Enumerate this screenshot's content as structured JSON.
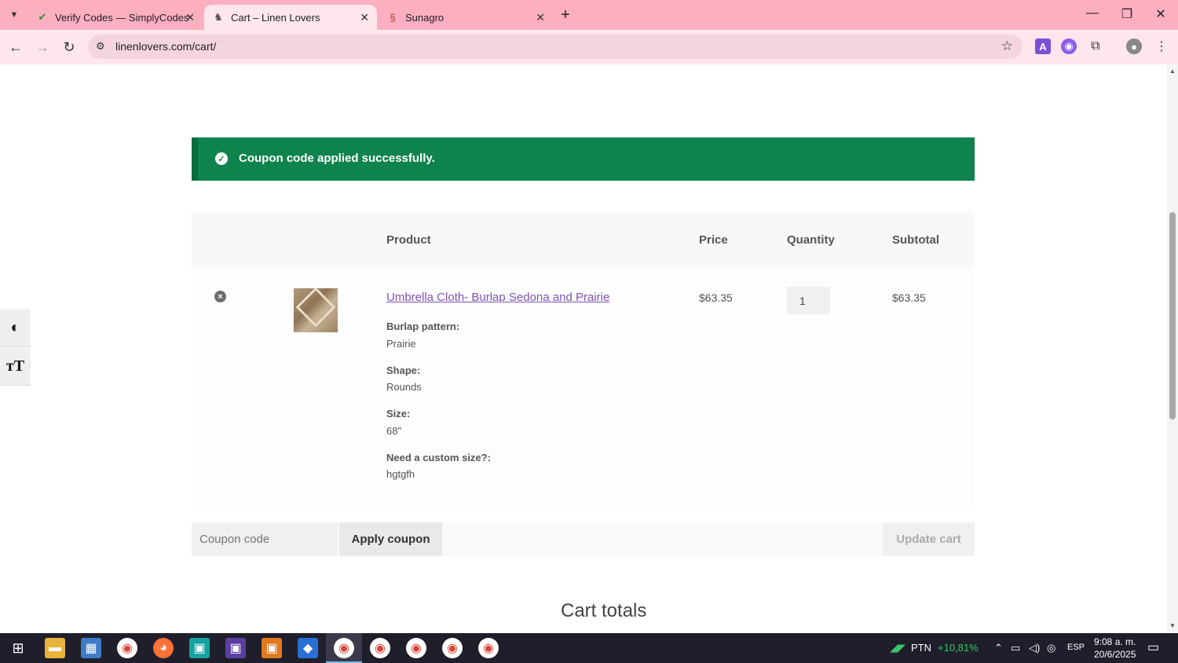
{
  "browser": {
    "tabs": [
      {
        "title": "Verify Codes — SimplyCodes",
        "active": false
      },
      {
        "title": "Cart – Linen Lovers",
        "active": true
      },
      {
        "title": "Sunagro",
        "active": false
      }
    ],
    "url": "linenlovers.com/cart/",
    "accent": "#fcafc1"
  },
  "notice": {
    "message": "Coupon code applied successfully.",
    "color": "#0f834d"
  },
  "cart": {
    "headers": {
      "product": "Product",
      "price": "Price",
      "quantity": "Quantity",
      "subtotal": "Subtotal"
    },
    "item": {
      "name": "Umbrella Cloth- Burlap Sedona and Prairie",
      "meta": [
        {
          "label": "Burlap pattern:",
          "value": "Prairie"
        },
        {
          "label": "Shape:",
          "value": "Rounds"
        },
        {
          "label": "Size:",
          "value": "68\""
        },
        {
          "label": "Need a custom size?:",
          "value": "hgtgfh"
        }
      ],
      "price": "$63.35",
      "quantity": "1",
      "subtotal": "$63.35"
    },
    "coupon_placeholder": "Coupon code",
    "apply_label": "Apply coupon",
    "update_label": "Update cart",
    "totals_title": "Cart totals"
  },
  "taskbar": {
    "stock_label": "PTN",
    "stock_change": "+10,81%",
    "language": "ESP",
    "time": "9:08 a. m.",
    "date": "20/6/2025"
  }
}
